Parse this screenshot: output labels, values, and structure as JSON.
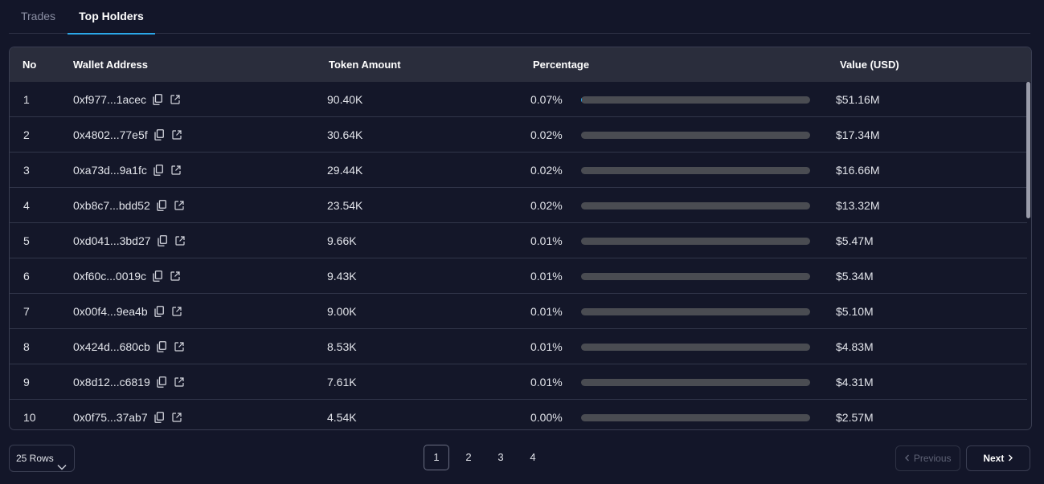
{
  "tabs": [
    {
      "label": "Trades",
      "active": false
    },
    {
      "label": "Top Holders",
      "active": true
    }
  ],
  "table": {
    "headers": {
      "no": "No",
      "address": "Wallet Address",
      "amount": "Token Amount",
      "percentage": "Percentage",
      "value": "Value (USD)"
    },
    "rows": [
      {
        "no": "1",
        "address": "0xf977...1acec",
        "amount": "90.40K",
        "percentage": "0.07%",
        "share": 0.0007,
        "value": "$51.16M"
      },
      {
        "no": "2",
        "address": "0x4802...77e5f",
        "amount": "30.64K",
        "percentage": "0.02%",
        "share": 0.0002,
        "value": "$17.34M"
      },
      {
        "no": "3",
        "address": "0xa73d...9a1fc",
        "amount": "29.44K",
        "percentage": "0.02%",
        "share": 0.0002,
        "value": "$16.66M"
      },
      {
        "no": "4",
        "address": "0xb8c7...bdd52",
        "amount": "23.54K",
        "percentage": "0.02%",
        "share": 0.0002,
        "value": "$13.32M"
      },
      {
        "no": "5",
        "address": "0xd041...3bd27",
        "amount": "9.66K",
        "percentage": "0.01%",
        "share": 0.0001,
        "value": "$5.47M"
      },
      {
        "no": "6",
        "address": "0xf60c...0019c",
        "amount": "9.43K",
        "percentage": "0.01%",
        "share": 0.0001,
        "value": "$5.34M"
      },
      {
        "no": "7",
        "address": "0x00f4...9ea4b",
        "amount": "9.00K",
        "percentage": "0.01%",
        "share": 0.0001,
        "value": "$5.10M"
      },
      {
        "no": "8",
        "address": "0x424d...680cb",
        "amount": "8.53K",
        "percentage": "0.01%",
        "share": 0.0001,
        "value": "$4.83M"
      },
      {
        "no": "9",
        "address": "0x8d12...c6819",
        "amount": "7.61K",
        "percentage": "0.01%",
        "share": 0.0001,
        "value": "$4.31M"
      },
      {
        "no": "10",
        "address": "0x0f75...37ab7",
        "amount": "4.54K",
        "percentage": "0.00%",
        "share": 0.0,
        "value": "$2.57M"
      }
    ]
  },
  "footer": {
    "rows_label": "25 Rows",
    "pages": [
      "1",
      "2",
      "3",
      "4"
    ],
    "current_page": "1",
    "prev_label": "Previous",
    "next_label": "Next"
  },
  "icons": {
    "copy": "copy-icon",
    "external": "external-link-icon",
    "chevron_down": "chevron-down-icon",
    "chevron_left": "chevron-left-icon",
    "chevron_right": "chevron-right-icon"
  },
  "colors": {
    "background": "#131629",
    "header_bg": "#2a2d3c",
    "accent": "#2ba7e8",
    "bar_track": "#4a4c52"
  }
}
